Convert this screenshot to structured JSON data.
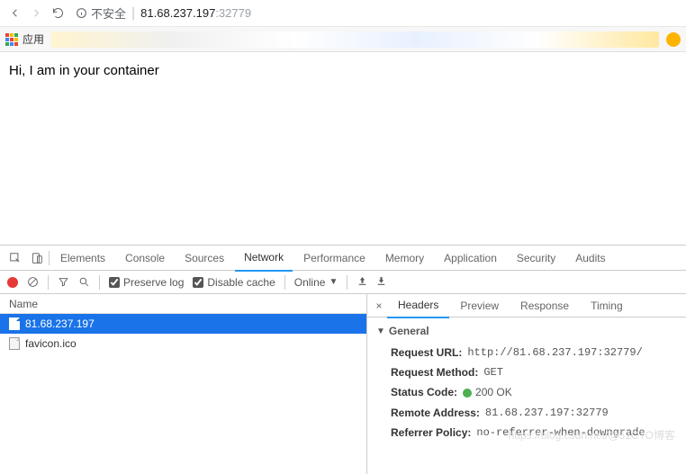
{
  "address_bar": {
    "security_label": "不安全",
    "host": "81.68.237.197",
    "port": ":32779"
  },
  "bookmarks": {
    "apps_label": "应用"
  },
  "page": {
    "body_text": "Hi, I am in your container"
  },
  "devtools": {
    "tabs": {
      "elements": "Elements",
      "console": "Console",
      "sources": "Sources",
      "network": "Network",
      "performance": "Performance",
      "memory": "Memory",
      "application": "Application",
      "security": "Security",
      "audits": "Audits"
    },
    "toolbar": {
      "preserve_log": "Preserve log",
      "disable_cache": "Disable cache",
      "online": "Online"
    },
    "request_list": {
      "col_name": "Name",
      "rows": [
        {
          "name": "81.68.237.197",
          "selected": true
        },
        {
          "name": "favicon.ico",
          "selected": false
        }
      ]
    },
    "detail_tabs": {
      "headers": "Headers",
      "preview": "Preview",
      "response": "Response",
      "timing": "Timing"
    },
    "general": {
      "heading": "General",
      "request_url_k": "Request URL:",
      "request_url_v": "http://81.68.237.197:32779/",
      "request_method_k": "Request Method:",
      "request_method_v": "GET",
      "status_code_k": "Status Code:",
      "status_code_v": "200 OK",
      "remote_address_k": "Remote Address:",
      "remote_address_v": "81.68.237.197:32779",
      "referrer_policy_k": "Referrer Policy:",
      "referrer_policy_v": "no-referrer-when-downgrade"
    }
  },
  "watermark": "https://blog.csdn.net/@51CTO博客"
}
